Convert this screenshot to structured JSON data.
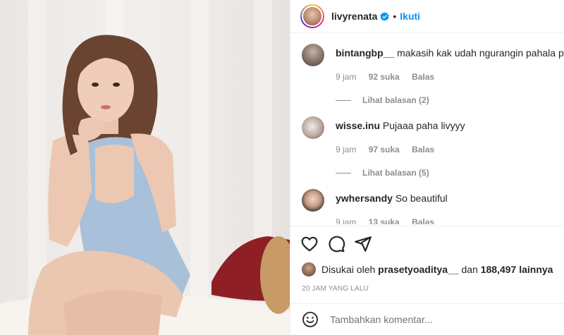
{
  "header": {
    "username": "livyrenata",
    "separator": "•",
    "follow_label": "Ikuti"
  },
  "comments": [
    {
      "username": "bintangbp__",
      "text": "makasih kak udah ngurangin pahala puasa",
      "time": "9 jam",
      "likes": "92 suka",
      "reply_label": "Balas",
      "view_replies": "Lihat balasan (2)"
    },
    {
      "username": "wisse.inu",
      "text": "Pujaaa paha livyyy",
      "time": "9 jam",
      "likes": "97 suka",
      "reply_label": "Balas",
      "view_replies": "Lihat balasan (5)"
    },
    {
      "username": "ywhersandy",
      "text": "So beautiful",
      "time": "9 jam",
      "likes": "13 suka",
      "reply_label": "Balas"
    }
  ],
  "likes": {
    "prefix": "Disukai oleh",
    "user": "prasetyoaditya__",
    "middle": "dan",
    "count": "188,497 lainnya"
  },
  "post_time": "20 JAM YANG LALU",
  "add_comment": {
    "placeholder": "Tambahkan komentar..."
  },
  "icons": {
    "like": "heart-icon",
    "comment": "comment-icon",
    "share": "share-icon",
    "emoji": "emoji-icon",
    "verified": "verified-badge-icon"
  },
  "colors": {
    "accent": "#0095f6",
    "secondary_text": "#8e8e8e"
  }
}
